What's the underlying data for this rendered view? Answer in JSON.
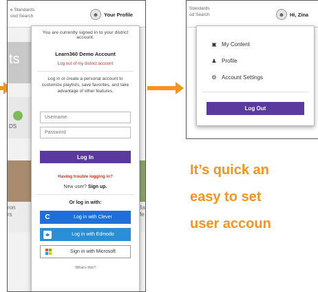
{
  "colors": {
    "accent_orange": "#f7941d",
    "purple": "#5b3aa0",
    "clever_blue": "#1e6fd9",
    "edmodo_blue": "#2a8fd6"
  },
  "left_screen": {
    "site_lines": [
      "e Standards",
      "ood Search"
    ],
    "profile_label": "Your Profile",
    "background_fragments": [
      "ts",
      "DS",
      "ron",
      "rs",
      "Ba",
      "ffe"
    ],
    "dropdown": {
      "signed_in_msg": "You are currently signed in to your district account.",
      "account_name": "Learn360 Demo Account",
      "logout_district": "Log out of my district account",
      "info_text": "Log in or create a personal account to customize playlists, save favorites, and take advantage of other features.",
      "username_placeholder": "Username",
      "password_placeholder": "Password",
      "login_button": "Log In",
      "trouble_link": "Having trouble logging in?",
      "new_user_text": "New user?",
      "signup_link": "Sign up.",
      "or_login": "Or log in with:",
      "clever_label": "Log in with Clever",
      "clever_icon_glyph": "C",
      "edmodo_label": "Log in with Edmodo",
      "microsoft_label": "Sign in with Microsoft",
      "whats_this": "What's this?"
    }
  },
  "right_screen": {
    "site_lines": [
      "Standards",
      "od Search"
    ],
    "greeting": "Hi, Zina",
    "menu": [
      {
        "icon": "briefcase-icon",
        "label": "My Content"
      },
      {
        "icon": "person-icon",
        "label": "Profile"
      },
      {
        "icon": "gear-icon",
        "label": "Account Settings"
      }
    ],
    "logout_button": "Log Out"
  },
  "tagline": [
    "It’s quick an",
    "easy to set",
    "user accoun"
  ]
}
